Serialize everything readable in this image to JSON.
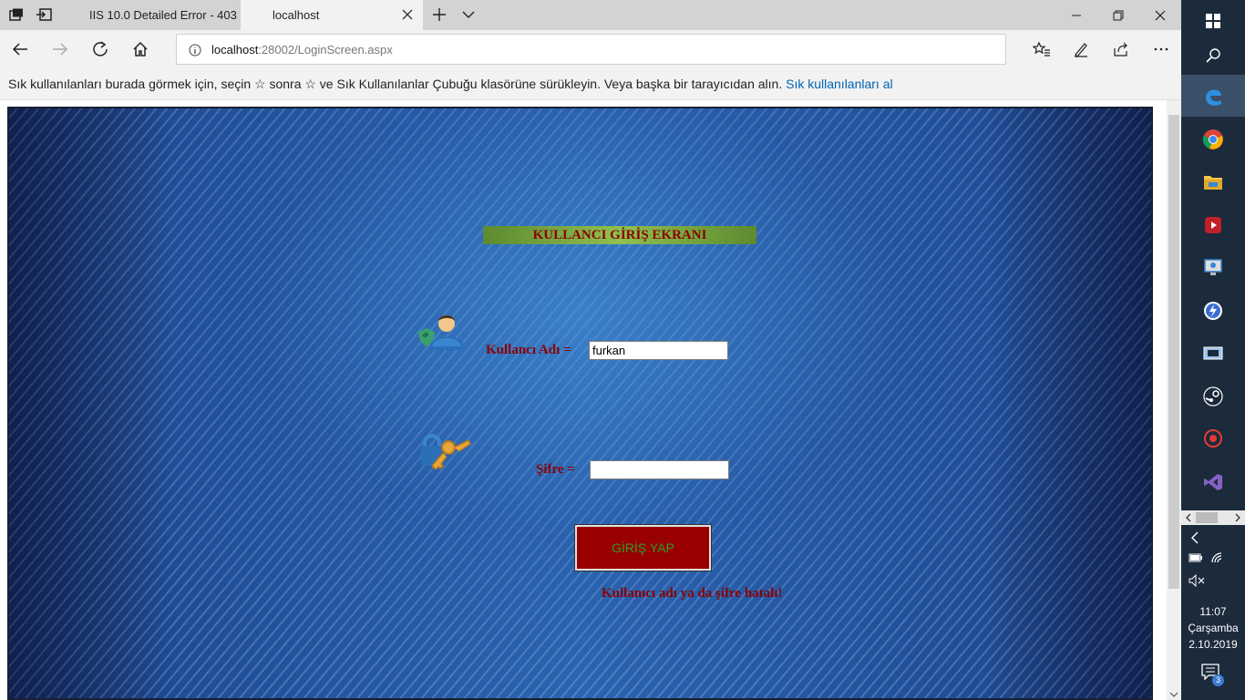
{
  "browser": {
    "tabs": [
      {
        "label": "IIS 10.0 Detailed Error - 403"
      },
      {
        "label": "localhost"
      }
    ],
    "address": {
      "host": "localhost",
      "path": ":28002/LoginScreen.aspx"
    },
    "favorites_bar": {
      "message": "Sık kullanılanları burada görmek için, seçin  ☆  sonra ☆ ve Sık Kullanılanlar Çubuğu klasörüne sürükleyin. Veya başka bir tarayıcıdan alın.",
      "link": "Sık kullanılanları al"
    }
  },
  "login": {
    "title": "KULLANCI GİRİŞ EKRANI",
    "username_label": "Kullancı Adı =",
    "username_value": "furkan",
    "password_label": "Şifre =",
    "password_value": "",
    "submit_label": "GİRİŞ YAP",
    "error_message": "Kullanıcı adı ya da şifre hatalı!"
  },
  "taskbar": {
    "time": "11:07",
    "day": "Çarşamba",
    "date": "2.10.2019",
    "notification_count": "3"
  },
  "colors": {
    "accent": "#8b0000",
    "button": "#990000",
    "button_text": "#2f9b2f",
    "link": "#0063b1"
  }
}
